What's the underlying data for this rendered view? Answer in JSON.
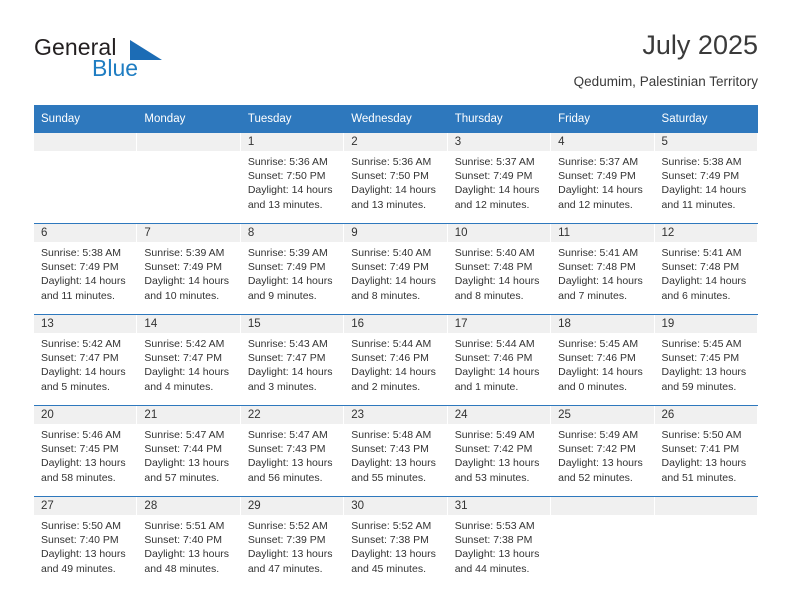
{
  "brand": {
    "name_part1": "General",
    "name_part2": "Blue",
    "accent_color": "#1c6cb5"
  },
  "header": {
    "title": "July 2025",
    "subtitle": "Qedumim, Palestinian Territory"
  },
  "calendar": {
    "header_bg": "#2e78bd",
    "daynum_bg": "#f0f0f0",
    "weekdays": [
      "Sunday",
      "Monday",
      "Tuesday",
      "Wednesday",
      "Thursday",
      "Friday",
      "Saturday"
    ],
    "weeks": [
      [
        {
          "day": "",
          "sunrise": "",
          "sunset": "",
          "daylight": "",
          "empty": true
        },
        {
          "day": "",
          "sunrise": "",
          "sunset": "",
          "daylight": "",
          "empty": true
        },
        {
          "day": "1",
          "sunrise": "Sunrise: 5:36 AM",
          "sunset": "Sunset: 7:50 PM",
          "daylight": "Daylight: 14 hours and 13 minutes."
        },
        {
          "day": "2",
          "sunrise": "Sunrise: 5:36 AM",
          "sunset": "Sunset: 7:50 PM",
          "daylight": "Daylight: 14 hours and 13 minutes."
        },
        {
          "day": "3",
          "sunrise": "Sunrise: 5:37 AM",
          "sunset": "Sunset: 7:49 PM",
          "daylight": "Daylight: 14 hours and 12 minutes."
        },
        {
          "day": "4",
          "sunrise": "Sunrise: 5:37 AM",
          "sunset": "Sunset: 7:49 PM",
          "daylight": "Daylight: 14 hours and 12 minutes."
        },
        {
          "day": "5",
          "sunrise": "Sunrise: 5:38 AM",
          "sunset": "Sunset: 7:49 PM",
          "daylight": "Daylight: 14 hours and 11 minutes."
        }
      ],
      [
        {
          "day": "6",
          "sunrise": "Sunrise: 5:38 AM",
          "sunset": "Sunset: 7:49 PM",
          "daylight": "Daylight: 14 hours and 11 minutes."
        },
        {
          "day": "7",
          "sunrise": "Sunrise: 5:39 AM",
          "sunset": "Sunset: 7:49 PM",
          "daylight": "Daylight: 14 hours and 10 minutes."
        },
        {
          "day": "8",
          "sunrise": "Sunrise: 5:39 AM",
          "sunset": "Sunset: 7:49 PM",
          "daylight": "Daylight: 14 hours and 9 minutes."
        },
        {
          "day": "9",
          "sunrise": "Sunrise: 5:40 AM",
          "sunset": "Sunset: 7:49 PM",
          "daylight": "Daylight: 14 hours and 8 minutes."
        },
        {
          "day": "10",
          "sunrise": "Sunrise: 5:40 AM",
          "sunset": "Sunset: 7:48 PM",
          "daylight": "Daylight: 14 hours and 8 minutes."
        },
        {
          "day": "11",
          "sunrise": "Sunrise: 5:41 AM",
          "sunset": "Sunset: 7:48 PM",
          "daylight": "Daylight: 14 hours and 7 minutes."
        },
        {
          "day": "12",
          "sunrise": "Sunrise: 5:41 AM",
          "sunset": "Sunset: 7:48 PM",
          "daylight": "Daylight: 14 hours and 6 minutes."
        }
      ],
      [
        {
          "day": "13",
          "sunrise": "Sunrise: 5:42 AM",
          "sunset": "Sunset: 7:47 PM",
          "daylight": "Daylight: 14 hours and 5 minutes."
        },
        {
          "day": "14",
          "sunrise": "Sunrise: 5:42 AM",
          "sunset": "Sunset: 7:47 PM",
          "daylight": "Daylight: 14 hours and 4 minutes."
        },
        {
          "day": "15",
          "sunrise": "Sunrise: 5:43 AM",
          "sunset": "Sunset: 7:47 PM",
          "daylight": "Daylight: 14 hours and 3 minutes."
        },
        {
          "day": "16",
          "sunrise": "Sunrise: 5:44 AM",
          "sunset": "Sunset: 7:46 PM",
          "daylight": "Daylight: 14 hours and 2 minutes."
        },
        {
          "day": "17",
          "sunrise": "Sunrise: 5:44 AM",
          "sunset": "Sunset: 7:46 PM",
          "daylight": "Daylight: 14 hours and 1 minute."
        },
        {
          "day": "18",
          "sunrise": "Sunrise: 5:45 AM",
          "sunset": "Sunset: 7:46 PM",
          "daylight": "Daylight: 14 hours and 0 minutes."
        },
        {
          "day": "19",
          "sunrise": "Sunrise: 5:45 AM",
          "sunset": "Sunset: 7:45 PM",
          "daylight": "Daylight: 13 hours and 59 minutes."
        }
      ],
      [
        {
          "day": "20",
          "sunrise": "Sunrise: 5:46 AM",
          "sunset": "Sunset: 7:45 PM",
          "daylight": "Daylight: 13 hours and 58 minutes."
        },
        {
          "day": "21",
          "sunrise": "Sunrise: 5:47 AM",
          "sunset": "Sunset: 7:44 PM",
          "daylight": "Daylight: 13 hours and 57 minutes."
        },
        {
          "day": "22",
          "sunrise": "Sunrise: 5:47 AM",
          "sunset": "Sunset: 7:43 PM",
          "daylight": "Daylight: 13 hours and 56 minutes."
        },
        {
          "day": "23",
          "sunrise": "Sunrise: 5:48 AM",
          "sunset": "Sunset: 7:43 PM",
          "daylight": "Daylight: 13 hours and 55 minutes."
        },
        {
          "day": "24",
          "sunrise": "Sunrise: 5:49 AM",
          "sunset": "Sunset: 7:42 PM",
          "daylight": "Daylight: 13 hours and 53 minutes."
        },
        {
          "day": "25",
          "sunrise": "Sunrise: 5:49 AM",
          "sunset": "Sunset: 7:42 PM",
          "daylight": "Daylight: 13 hours and 52 minutes."
        },
        {
          "day": "26",
          "sunrise": "Sunrise: 5:50 AM",
          "sunset": "Sunset: 7:41 PM",
          "daylight": "Daylight: 13 hours and 51 minutes."
        }
      ],
      [
        {
          "day": "27",
          "sunrise": "Sunrise: 5:50 AM",
          "sunset": "Sunset: 7:40 PM",
          "daylight": "Daylight: 13 hours and 49 minutes."
        },
        {
          "day": "28",
          "sunrise": "Sunrise: 5:51 AM",
          "sunset": "Sunset: 7:40 PM",
          "daylight": "Daylight: 13 hours and 48 minutes."
        },
        {
          "day": "29",
          "sunrise": "Sunrise: 5:52 AM",
          "sunset": "Sunset: 7:39 PM",
          "daylight": "Daylight: 13 hours and 47 minutes."
        },
        {
          "day": "30",
          "sunrise": "Sunrise: 5:52 AM",
          "sunset": "Sunset: 7:38 PM",
          "daylight": "Daylight: 13 hours and 45 minutes."
        },
        {
          "day": "31",
          "sunrise": "Sunrise: 5:53 AM",
          "sunset": "Sunset: 7:38 PM",
          "daylight": "Daylight: 13 hours and 44 minutes."
        },
        {
          "day": "",
          "sunrise": "",
          "sunset": "",
          "daylight": "",
          "empty": true
        },
        {
          "day": "",
          "sunrise": "",
          "sunset": "",
          "daylight": "",
          "empty": true
        }
      ]
    ]
  }
}
